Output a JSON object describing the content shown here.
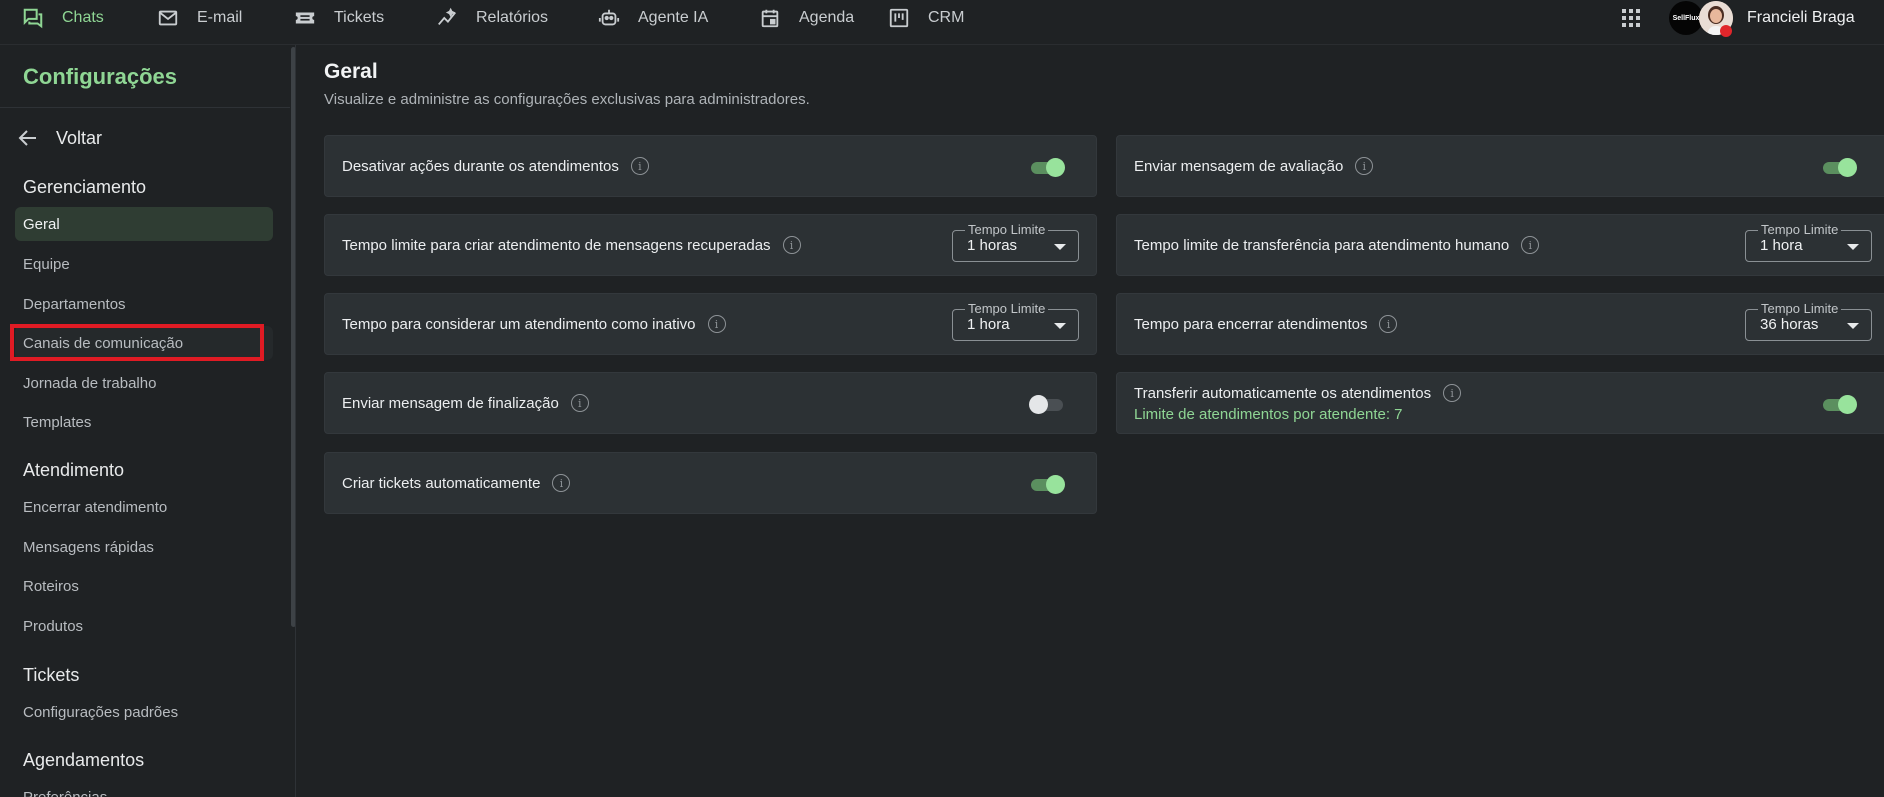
{
  "topnav": {
    "items": [
      {
        "label": "Chats",
        "icon": "chat-icon",
        "active": true
      },
      {
        "label": "E-mail",
        "icon": "mail-icon"
      },
      {
        "label": "Tickets",
        "icon": "ticket-icon"
      },
      {
        "label": "Relatórios",
        "icon": "reports-icon"
      },
      {
        "label": "Agente IA",
        "icon": "robot-icon"
      },
      {
        "label": "Agenda",
        "icon": "calendar-icon"
      },
      {
        "label": "CRM",
        "icon": "kanban-icon"
      }
    ],
    "logo_text": "SellFlux",
    "user_name": "Francieli Braga"
  },
  "sidebar": {
    "title": "Configurações",
    "back_label": "Voltar",
    "sections": [
      {
        "title": "Gerenciamento",
        "items": [
          "Geral",
          "Equipe",
          "Departamentos",
          "Canais de comunicação",
          "Jornada de trabalho",
          "Templates"
        ]
      },
      {
        "title": "Atendimento",
        "items": [
          "Encerrar atendimento",
          "Mensagens rápidas",
          "Roteiros",
          "Produtos"
        ]
      },
      {
        "title": "Tickets",
        "items": [
          "Configurações padrões"
        ]
      },
      {
        "title": "Agendamentos",
        "items": [
          "Preferências"
        ]
      }
    ],
    "active_item": "Geral",
    "highlighted_item": "Canais de comunicação"
  },
  "main": {
    "title": "Geral",
    "subtitle": "Visualize e administre as configurações exclusivas para administradores.",
    "cards": {
      "desativar": {
        "label": "Desativar ações durante os atendimentos",
        "toggle_on": true
      },
      "avaliacao": {
        "label": "Enviar mensagem de avaliação",
        "toggle_on": true
      },
      "recuperadas": {
        "label": "Tempo limite para criar atendimento de mensagens recuperadas",
        "select_legend": "Tempo Limite",
        "select_value": "1 horas"
      },
      "transferencia": {
        "label": "Tempo limite de transferência para atendimento humano",
        "select_legend": "Tempo Limite",
        "select_value": "1 hora"
      },
      "inativo": {
        "label": "Tempo para considerar um atendimento como inativo",
        "select_legend": "Tempo Limite",
        "select_value": "1 hora"
      },
      "encerrar": {
        "label": "Tempo para encerrar atendimentos",
        "select_legend": "Tempo Limite",
        "select_value": "36 horas"
      },
      "finalizacao": {
        "label": "Enviar mensagem de finalização",
        "toggle_on": false
      },
      "transferir_auto": {
        "label": "Transferir automaticamente os atendimentos",
        "sub_label": "Limite de atendimentos por atendente: 7",
        "toggle_on": true
      },
      "tickets_auto": {
        "label": "Criar tickets automaticamente",
        "toggle_on": true
      }
    },
    "info_glyph": "i"
  },
  "colors": {
    "accent": "#8fd694",
    "background": "#1f2224",
    "card": "#2c3134",
    "highlight_box": "#e01b24"
  }
}
